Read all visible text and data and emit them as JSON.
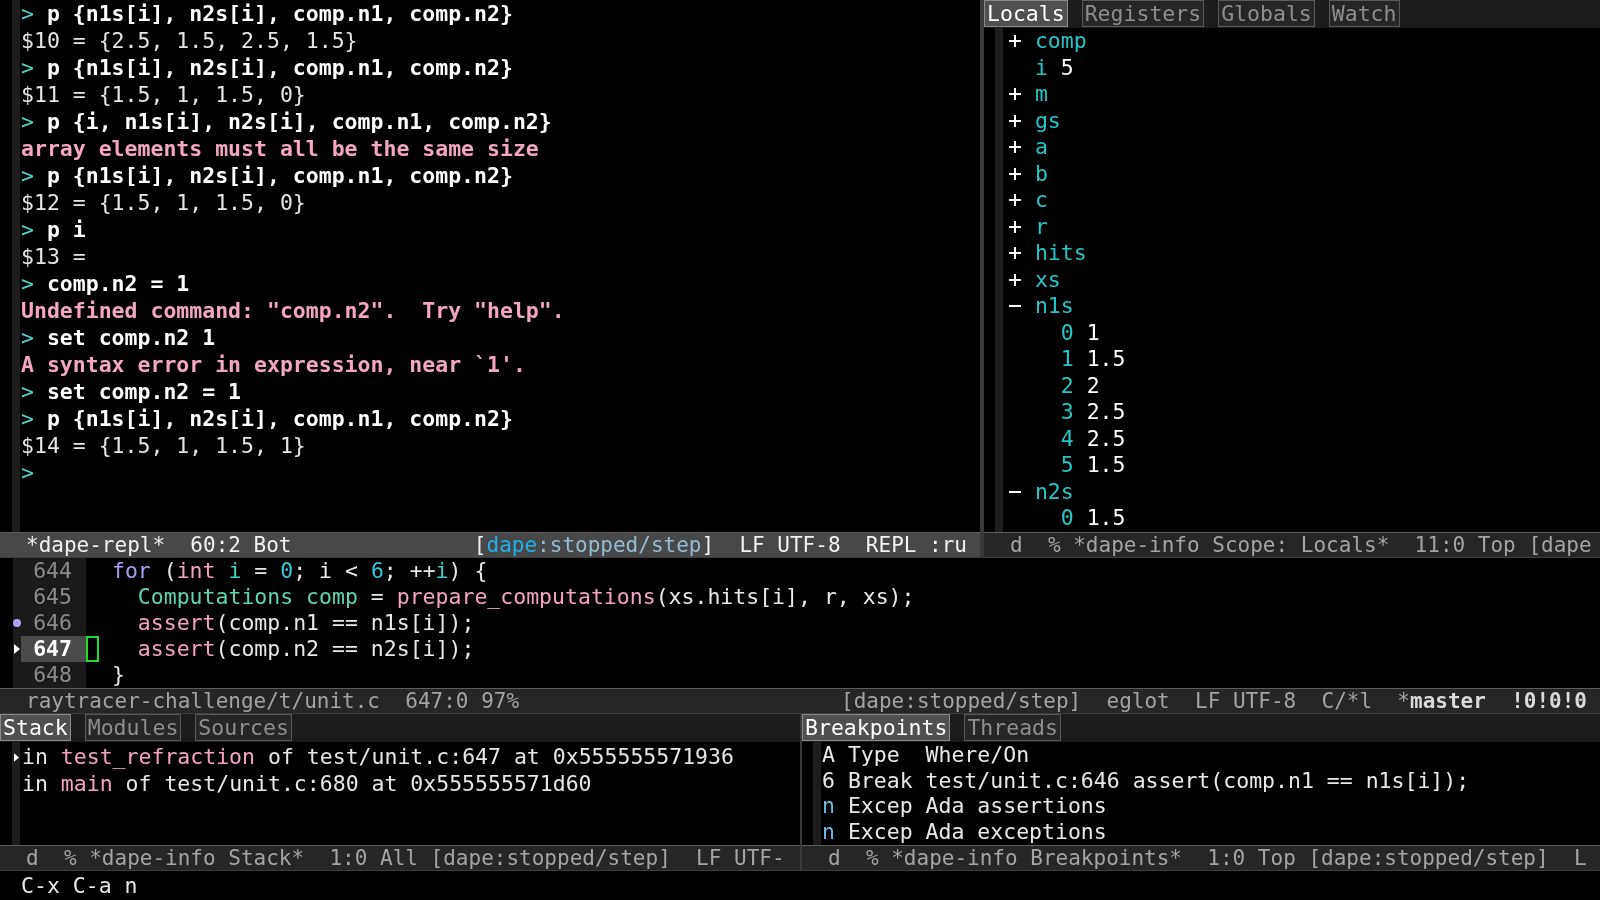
{
  "repl": {
    "lines": [
      {
        "kind": "input",
        "prompt": ">",
        "text": "p {n1s[i], n2s[i], comp.n1, comp.n2}"
      },
      {
        "kind": "output",
        "text": "$10 = {2.5, 1.5, 2.5, 1.5}"
      },
      {
        "kind": "input",
        "prompt": ">",
        "text": "p {n1s[i], n2s[i], comp.n1, comp.n2}"
      },
      {
        "kind": "output",
        "text": "$11 = {1.5, 1, 1.5, 0}"
      },
      {
        "kind": "input",
        "prompt": ">",
        "text": "p {i, n1s[i], n2s[i], comp.n1, comp.n2}"
      },
      {
        "kind": "error",
        "text": "array elements must all be the same size"
      },
      {
        "kind": "input",
        "prompt": ">",
        "text": "p {n1s[i], n2s[i], comp.n1, comp.n2}"
      },
      {
        "kind": "output",
        "text": "$12 = {1.5, 1, 1.5, 0}"
      },
      {
        "kind": "input",
        "prompt": ">",
        "text": "p i"
      },
      {
        "kind": "output",
        "text": "$13 ="
      },
      {
        "kind": "input",
        "prompt": ">",
        "text": "comp.n2 = 1"
      },
      {
        "kind": "error",
        "text": "Undefined command: \"comp.n2\".  Try \"help\"."
      },
      {
        "kind": "input",
        "prompt": ">",
        "text": "set comp.n2 1"
      },
      {
        "kind": "error",
        "text": "A syntax error in expression, near `1'."
      },
      {
        "kind": "input",
        "prompt": ">",
        "text": "set comp.n2 = 1"
      },
      {
        "kind": "input",
        "prompt": ">",
        "text": "p {n1s[i], n2s[i], comp.n1, comp.n2}"
      },
      {
        "kind": "output",
        "text": "$14 = {1.5, 1, 1.5, 1}"
      },
      {
        "kind": "input",
        "prompt": ">"
      }
    ],
    "mode_line": {
      "active": true,
      "left": [
        {
          "segments": [
            {
              "text": "*dape-repl*"
            }
          ]
        },
        {
          "segments": [
            {
              "text": "60:2 Bot"
            }
          ]
        }
      ],
      "right": [
        {
          "segments": [
            {
              "text": "[",
              "kind": "plain"
            },
            {
              "text": "dape",
              "kind": "tool"
            },
            {
              "text": ":stopped/step",
              "kind": "state"
            },
            {
              "text": "]",
              "kind": "plain"
            }
          ]
        },
        {
          "segments": [
            {
              "text": "LF UTF-8"
            }
          ]
        },
        {
          "segments": [
            {
              "text": "REPL :ru"
            }
          ]
        }
      ]
    }
  },
  "scope": {
    "tabs": [
      {
        "label": "Locals",
        "selected": true
      },
      {
        "label": "Registers",
        "selected": false
      },
      {
        "label": "Globals",
        "selected": false
      },
      {
        "label": "Watch",
        "selected": false
      }
    ],
    "variables": [
      {
        "name": "comp",
        "expanded": false
      },
      {
        "name": "i",
        "value": "5"
      },
      {
        "name": "m",
        "expanded": false
      },
      {
        "name": "gs",
        "expanded": false
      },
      {
        "name": "a",
        "expanded": false
      },
      {
        "name": "b",
        "expanded": false
      },
      {
        "name": "c",
        "expanded": false
      },
      {
        "name": "r",
        "expanded": false
      },
      {
        "name": "hits",
        "expanded": false
      },
      {
        "name": "xs",
        "expanded": false
      },
      {
        "name": "n1s",
        "expanded": true,
        "children": [
          {
            "name": "0",
            "value": "1"
          },
          {
            "name": "1",
            "value": "1.5"
          },
          {
            "name": "2",
            "value": "2"
          },
          {
            "name": "3",
            "value": "2.5"
          },
          {
            "name": "4",
            "value": "2.5"
          },
          {
            "name": "5",
            "value": "1.5"
          }
        ]
      },
      {
        "name": "n2s",
        "expanded": true,
        "children": [
          {
            "name": "0",
            "value": "1.5"
          }
        ]
      }
    ],
    "mode_line": {
      "active": false,
      "left": [
        {
          "segments": [
            {
              "text": "d"
            }
          ]
        },
        {
          "segments": [
            {
              "text": "% *dape-info Scope: Locals*"
            }
          ]
        },
        {
          "segments": [
            {
              "text": "11:0 Top [dape"
            }
          ]
        }
      ]
    }
  },
  "source": {
    "lines": [
      {
        "number": "644",
        "current": false,
        "breakpoint": false,
        "cursor": false,
        "tokens": [
          {
            "text": "for",
            "kind": "keyword"
          },
          {
            "text": " (",
            "kind": "plain"
          },
          {
            "text": "int ",
            "kind": "builtin"
          },
          {
            "text": "i",
            "kind": "variable"
          },
          {
            "text": " = ",
            "kind": "plain"
          },
          {
            "text": "0",
            "kind": "number"
          },
          {
            "text": "; i < ",
            "kind": "plain"
          },
          {
            "text": "6",
            "kind": "number"
          },
          {
            "text": "; ++",
            "kind": "plain"
          },
          {
            "text": "i",
            "kind": "variable"
          },
          {
            "text": ") {",
            "kind": "plain"
          }
        ],
        "children": [
          {
            "number": "645",
            "current": false,
            "breakpoint": false,
            "cursor": false,
            "tokens": [
              {
                "text": "Computations comp",
                "kind": "type"
              },
              {
                "text": " = ",
                "kind": "plain"
              },
              {
                "text": "prepare_computations",
                "kind": "function"
              },
              {
                "text": "(xs.hits[i], r, xs);",
                "kind": "plain"
              }
            ]
          },
          {
            "number": "646",
            "current": false,
            "breakpoint": true,
            "cursor": false,
            "tokens": [
              {
                "text": "assert",
                "kind": "function"
              },
              {
                "text": "(comp.n1 == n1s[i]);",
                "kind": "plain"
              }
            ]
          },
          {
            "number": "647",
            "current": true,
            "breakpoint": false,
            "cursor": true,
            "tokens": [
              {
                "text": "assert",
                "kind": "function"
              },
              {
                "text": "(comp.n2 == n2s[i]);",
                "kind": "plain"
              }
            ]
          }
        ]
      },
      {
        "number": "648",
        "current": false,
        "breakpoint": false,
        "cursor": false,
        "tokens": [
          {
            "text": "}",
            "kind": "plain"
          }
        ]
      }
    ],
    "mode_line": {
      "active": false,
      "left": [
        {
          "segments": [
            {
              "text": "raytracer-challenge/t/unit.c"
            }
          ]
        },
        {
          "segments": [
            {
              "text": "647:0 97%"
            }
          ]
        }
      ],
      "right": [
        {
          "segments": [
            {
              "text": "[dape:stopped/step]"
            }
          ]
        },
        {
          "segments": [
            {
              "text": "eglot"
            }
          ]
        },
        {
          "segments": [
            {
              "text": "LF UTF-8"
            }
          ]
        },
        {
          "segments": [
            {
              "text": "C/*l"
            }
          ]
        },
        {
          "segments": [
            {
              "text": "*",
              "kind": "plain"
            },
            {
              "text": "master",
              "kind": "branch"
            }
          ]
        },
        {
          "segments": [
            {
              "text": "!0!0!0",
              "kind": "count"
            }
          ]
        }
      ]
    }
  },
  "stack": {
    "tabs": [
      {
        "label": "Stack",
        "selected": true
      },
      {
        "label": "Modules",
        "selected": false
      },
      {
        "label": "Sources",
        "selected": false
      }
    ],
    "frames": [
      {
        "selected": true,
        "prefix": "in",
        "function": "test_refraction",
        "rest": "of test/unit.c:647 at 0x555555571936"
      },
      {
        "selected": false,
        "prefix": "in",
        "function": "main",
        "rest": "of test/unit.c:680 at 0x555555571d60"
      }
    ],
    "mode_line": {
      "active": false,
      "left": [
        {
          "segments": [
            {
              "text": "d"
            }
          ]
        },
        {
          "segments": [
            {
              "text": "% *dape-info Stack*"
            }
          ]
        },
        {
          "segments": [
            {
              "text": "1:0 All [dape:stopped/step]"
            }
          ]
        },
        {
          "segments": [
            {
              "text": "LF UTF-"
            }
          ]
        }
      ]
    }
  },
  "breakpoints": {
    "tabs": [
      {
        "label": "Breakpoints",
        "selected": true
      },
      {
        "label": "Threads",
        "selected": false
      }
    ],
    "columns": [
      "A",
      "Type",
      "Where/On"
    ],
    "rows": [
      {
        "kind": "source",
        "a": "6",
        "type": "Break",
        "where": "test/unit.c:646 assert(comp.n1 == n1s[i]);"
      },
      {
        "kind": "exception",
        "a": "n",
        "type": "Excep",
        "where": "Ada assertions"
      },
      {
        "kind": "exception",
        "a": "n",
        "type": "Excep",
        "where": "Ada exceptions"
      }
    ],
    "mode_line": {
      "active": false,
      "left": [
        {
          "segments": [
            {
              "text": "d"
            }
          ]
        },
        {
          "segments": [
            {
              "text": "% *dape-info Breakpoints*"
            }
          ]
        },
        {
          "segments": [
            {
              "text": "1:0 Top [dape:stopped/step]"
            }
          ]
        },
        {
          "segments": [
            {
              "text": "L"
            }
          ]
        }
      ]
    }
  },
  "echo_area": {
    "text": "C-x C-a n"
  }
}
